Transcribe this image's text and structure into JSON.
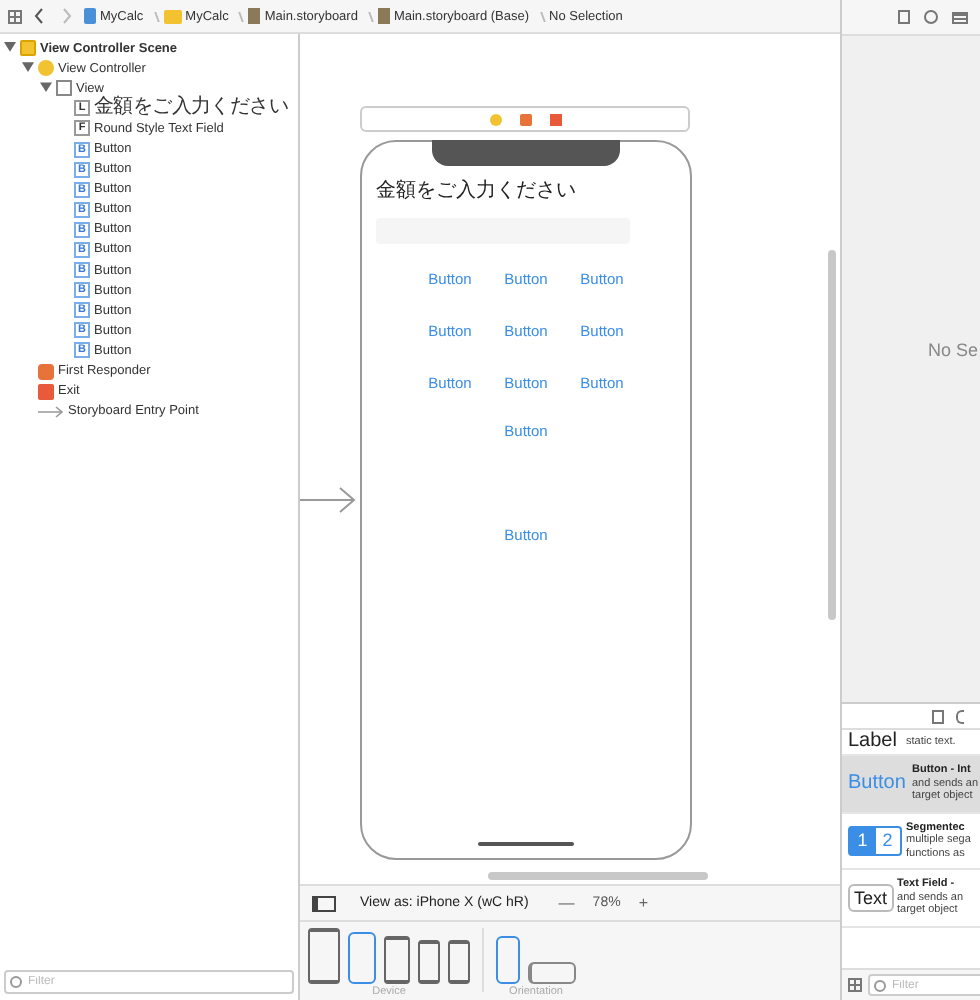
{
  "breadcrumb": [
    {
      "label": "MyCalc",
      "kind": "project"
    },
    {
      "label": "MyCalc",
      "kind": "folder"
    },
    {
      "label": "Main.storyboard",
      "kind": "file"
    },
    {
      "label": "Main.storyboard (Base)",
      "kind": "file"
    },
    {
      "label": "No Selection",
      "kind": "plain"
    }
  ],
  "outline": [
    {
      "label": "View Controller Scene",
      "kind": "scene",
      "expanded": true,
      "children": [
        {
          "label": "View Controller",
          "kind": "controller",
          "expanded": true,
          "children": [
            {
              "label": "View",
              "kind": "view",
              "expanded": true,
              "children": [
                {
                  "label": "金額をご入力ください",
                  "kind": "label",
                  "badge": "L"
                },
                {
                  "label": "Round Style Text Field",
                  "kind": "field",
                  "badge": "F"
                },
                {
                  "label": "Button",
                  "kind": "button",
                  "badge": "B"
                },
                {
                  "label": "Button",
                  "kind": "button",
                  "badge": "B"
                },
                {
                  "label": "Button",
                  "kind": "button",
                  "badge": "B"
                },
                {
                  "label": "Button",
                  "kind": "button",
                  "badge": "B"
                },
                {
                  "label": "Button",
                  "kind": "button",
                  "badge": "B"
                },
                {
                  "label": "Button",
                  "kind": "button",
                  "badge": "B"
                },
                {
                  "label": "Button",
                  "kind": "button",
                  "badge": "B"
                },
                {
                  "label": "Button",
                  "kind": "button",
                  "badge": "B"
                },
                {
                  "label": "Button",
                  "kind": "button",
                  "badge": "B"
                },
                {
                  "label": "Button",
                  "kind": "button",
                  "badge": "B"
                },
                {
                  "label": "Button",
                  "kind": "button",
                  "badge": "B"
                }
              ]
            }
          ]
        },
        {
          "label": "First Responder",
          "kind": "responder"
        },
        {
          "label": "Exit",
          "kind": "exit"
        },
        {
          "label": "Storyboard Entry Point",
          "kind": "entry"
        }
      ]
    }
  ],
  "outline_filter": {
    "placeholder": "Filter"
  },
  "phone": {
    "title": "金額をご入力ください",
    "button_rows": [
      [
        "Button",
        "Button",
        "Button"
      ],
      [
        "Button",
        "Button",
        "Button"
      ],
      [
        "Button",
        "Button",
        "Button"
      ],
      [
        "Button"
      ],
      [
        "Button"
      ]
    ]
  },
  "view_as": {
    "label": "View as: iPhone X (wC hR)",
    "zoom_out": "—",
    "zoom": "78%",
    "zoom_in": "+"
  },
  "devices": [
    {
      "kind": "large",
      "selected": false
    },
    {
      "kind": "notch",
      "selected": true
    },
    {
      "kind": "medium",
      "selected": false
    },
    {
      "kind": "small",
      "selected": false
    },
    {
      "kind": "small",
      "selected": false
    }
  ],
  "device_label": "Device",
  "orientations": [
    {
      "kind": "portrait",
      "selected": true
    },
    {
      "kind": "landscape",
      "selected": false
    }
  ],
  "orientation_label": "Orientation",
  "inspector": {
    "message": "No Se"
  },
  "library": [
    {
      "kind": "label",
      "icon_text": "Label",
      "lines": [
        "static text."
      ]
    },
    {
      "kind": "button",
      "icon_text": "Button",
      "title": "Button - Int",
      "lines": [
        "and sends an",
        "target object"
      ],
      "selected": true
    },
    {
      "kind": "segmented",
      "icon_text": [
        "1",
        "2"
      ],
      "title": "Segmentec",
      "lines": [
        "multiple sega",
        "functions as"
      ],
      "selected": false
    },
    {
      "kind": "textfield",
      "icon_text": "Text",
      "title": "Text Field -",
      "lines": [
        "and sends an",
        "target object"
      ],
      "selected": false
    }
  ],
  "library_filter": {
    "placeholder": "Filter"
  }
}
